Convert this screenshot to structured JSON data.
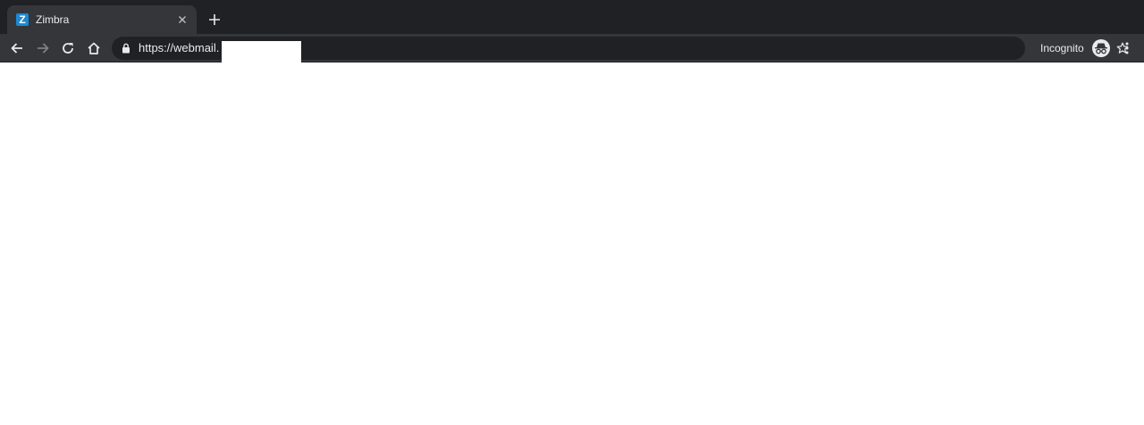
{
  "browser": {
    "mode": "incognito",
    "incognito_label": "Incognito",
    "colors": {
      "tabstrip": "#202124",
      "toolbar": "#35363a",
      "omnibox": "#202124",
      "text": "#e8eaed",
      "favicon": "#1b8ad4"
    }
  },
  "tabs": [
    {
      "title": "Zimbra",
      "favicon_letter": "Z",
      "favicon_icon": "zimbra-icon",
      "active": true
    }
  ],
  "toolbar": {
    "back_icon": "arrow-left-icon",
    "forward_icon": "arrow-right-icon",
    "reload_icon": "reload-icon",
    "home_icon": "home-icon",
    "star_icon": "star-icon",
    "menu_icon": "kebab-menu-icon"
  },
  "address_bar": {
    "url": "https://webmail.",
    "secure_icon": "lock-icon"
  },
  "page": {
    "state": "blank"
  }
}
